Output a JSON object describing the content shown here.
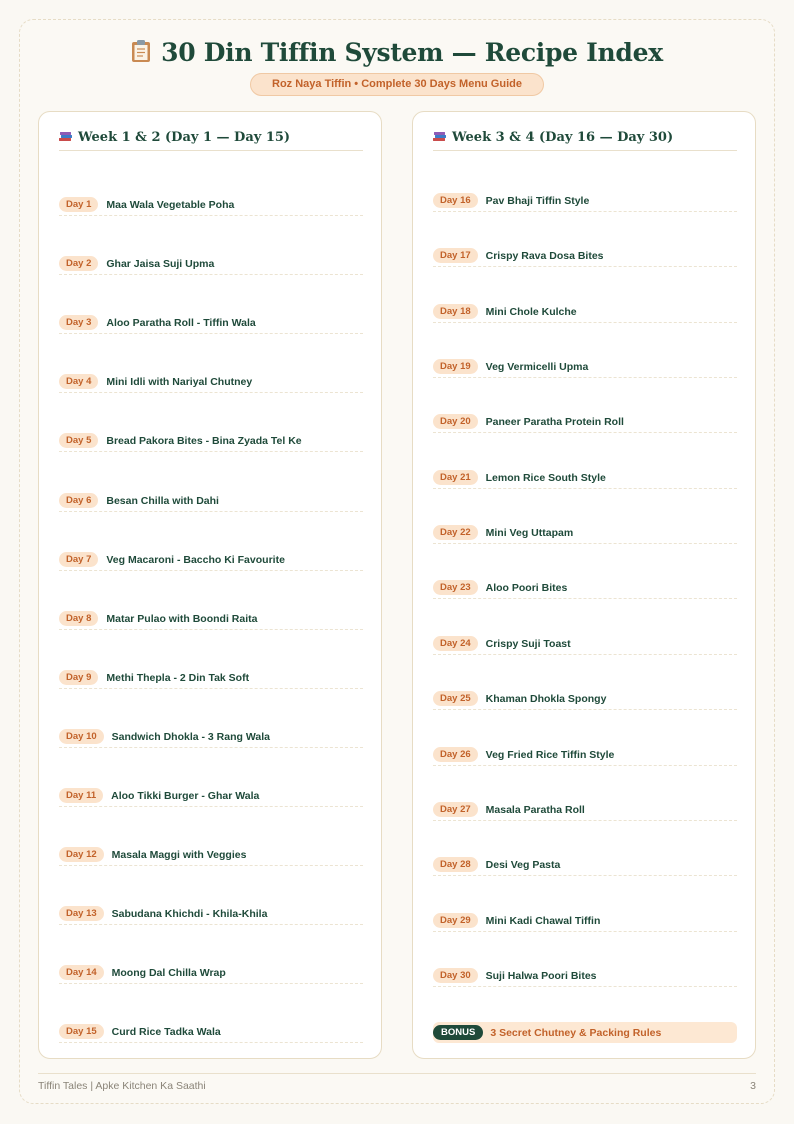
{
  "header": {
    "title": "30 Din Tiffin System — Recipe Index",
    "title_icon": "clipboard-icon",
    "subtitle": "Roz Naya Tiffin • Complete 30 Days Menu Guide"
  },
  "left_card": {
    "heading": "Week 1 & 2 (Day 1 — Day 15)",
    "heading_icon": "books-icon",
    "items": [
      {
        "day": "Day 1",
        "name": "Maa Wala Vegetable Poha"
      },
      {
        "day": "Day 2",
        "name": "Ghar Jaisa Suji Upma"
      },
      {
        "day": "Day 3",
        "name": "Aloo Paratha Roll - Tiffin Wala"
      },
      {
        "day": "Day 4",
        "name": "Mini Idli with Nariyal Chutney"
      },
      {
        "day": "Day 5",
        "name": "Bread Pakora Bites - Bina Zyada Tel Ke"
      },
      {
        "day": "Day 6",
        "name": "Besan Chilla with Dahi"
      },
      {
        "day": "Day 7",
        "name": "Veg Macaroni - Baccho Ki Favourite"
      },
      {
        "day": "Day 8",
        "name": "Matar Pulao with Boondi Raita"
      },
      {
        "day": "Day 9",
        "name": "Methi Thepla - 2 Din Tak Soft"
      },
      {
        "day": "Day 10",
        "name": "Sandwich Dhokla - 3 Rang Wala"
      },
      {
        "day": "Day 11",
        "name": "Aloo Tikki Burger - Ghar Wala"
      },
      {
        "day": "Day 12",
        "name": "Masala Maggi with Veggies"
      },
      {
        "day": "Day 13",
        "name": "Sabudana Khichdi - Khila-Khila"
      },
      {
        "day": "Day 14",
        "name": "Moong Dal Chilla Wrap"
      },
      {
        "day": "Day 15",
        "name": "Curd Rice Tadka Wala"
      }
    ]
  },
  "right_card": {
    "heading": "Week 3 & 4 (Day 16 — Day 30)",
    "heading_icon": "books-icon",
    "items": [
      {
        "day": "Day 16",
        "name": "Pav Bhaji Tiffin Style"
      },
      {
        "day": "Day 17",
        "name": "Crispy Rava Dosa Bites"
      },
      {
        "day": "Day 18",
        "name": "Mini Chole Kulche"
      },
      {
        "day": "Day 19",
        "name": "Veg Vermicelli Upma"
      },
      {
        "day": "Day 20",
        "name": "Paneer Paratha Protein Roll"
      },
      {
        "day": "Day 21",
        "name": "Lemon Rice South Style"
      },
      {
        "day": "Day 22",
        "name": "Mini Veg Uttapam"
      },
      {
        "day": "Day 23",
        "name": "Aloo Poori Bites"
      },
      {
        "day": "Day 24",
        "name": "Crispy Suji Toast"
      },
      {
        "day": "Day 25",
        "name": "Khaman Dhokla Spongy"
      },
      {
        "day": "Day 26",
        "name": "Veg Fried Rice Tiffin Style"
      },
      {
        "day": "Day 27",
        "name": "Masala Paratha Roll"
      },
      {
        "day": "Day 28",
        "name": "Desi Veg Pasta"
      },
      {
        "day": "Day 29",
        "name": "Mini Kadi Chawal Tiffin"
      },
      {
        "day": "Day 30",
        "name": "Suji Halwa Poori Bites"
      }
    ],
    "bonus": {
      "tag": "BONUS",
      "text": "3 Secret Chutney & Packing Rules"
    }
  },
  "footer": {
    "left": "Tiffin Tales | Apke Kitchen Ka Saathi",
    "page_number": "3"
  },
  "colors": {
    "primary_green": "#1f4a3a",
    "accent_orange": "#c2622a",
    "pill_bg": "#fbe3cc",
    "page_bg": "#faf8f3"
  }
}
